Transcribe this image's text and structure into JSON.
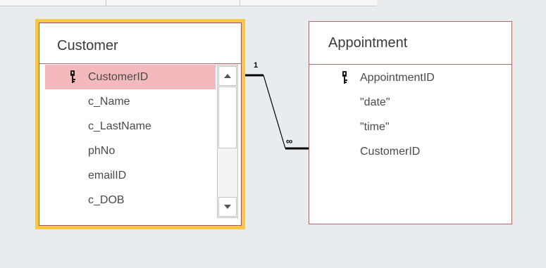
{
  "relationship": {
    "one_side": "1",
    "many_side": "∞"
  },
  "customer_table": {
    "title": "Customer",
    "fields": [
      {
        "name": "CustomerID",
        "primary_key": true,
        "selected": true
      },
      {
        "name": "c_Name"
      },
      {
        "name": "c_LastName"
      },
      {
        "name": "phNo"
      },
      {
        "name": "emailID"
      },
      {
        "name": "c_DOB"
      }
    ]
  },
  "appointment_table": {
    "title": "Appointment",
    "fields": [
      {
        "name": "AppointmentID",
        "primary_key": true
      },
      {
        "name": "\"date\""
      },
      {
        "name": "\"time\""
      },
      {
        "name": "CustomerID"
      }
    ]
  },
  "colors": {
    "selected_table_border": "#f6c744",
    "selected_field": "#f4b9bc",
    "table_border": "#b06a6a",
    "canvas": "#e9ecef"
  },
  "icons": {
    "primary_key": "key-icon",
    "scroll_up": "triangle-up-icon",
    "scroll_down": "triangle-down-icon"
  }
}
